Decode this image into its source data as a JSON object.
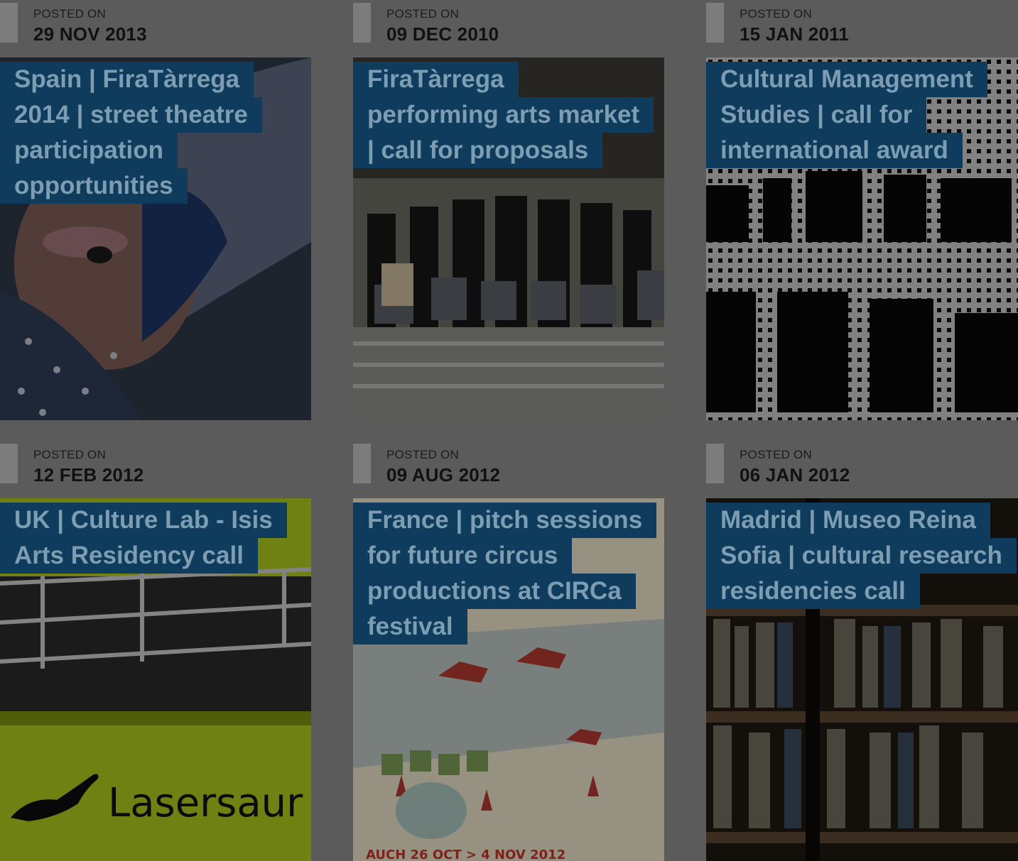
{
  "posts": [
    {
      "posted_label": "POSTED ON",
      "date": "29 NOV 2013",
      "title_lines": [
        "Spain | FiraTàrrega",
        "2014 | street theatre",
        "participation",
        "opportunities"
      ]
    },
    {
      "posted_label": "POSTED ON",
      "date": "09 DEC 2010",
      "title_lines": [
        "FiraTàrrega",
        "performing arts market",
        "| call for proposals"
      ]
    },
    {
      "posted_label": "POSTED ON",
      "date": "15 JAN 2011",
      "title_lines": [
        "Cultural Management",
        "Studies | call for",
        "international award"
      ]
    },
    {
      "posted_label": "POSTED ON",
      "date": "12 FEB 2012",
      "title_lines": [
        "UK | Culture Lab - Isis",
        "Arts Residency call"
      ],
      "image_text": "Lasersaur"
    },
    {
      "posted_label": "POSTED ON",
      "date": "09 AUG 2012",
      "title_lines": [
        "France | pitch sessions",
        "for future circus",
        "productions at CIRCa",
        "festival"
      ],
      "image_text": "AUCH 26 OCT > 4 NOV 2012"
    },
    {
      "posted_label": "POSTED ON",
      "date": "06 JAN 2012",
      "title_lines": [
        "Madrid | Museo Reina",
        "Sofia | cultural research",
        "residencies call"
      ]
    }
  ]
}
